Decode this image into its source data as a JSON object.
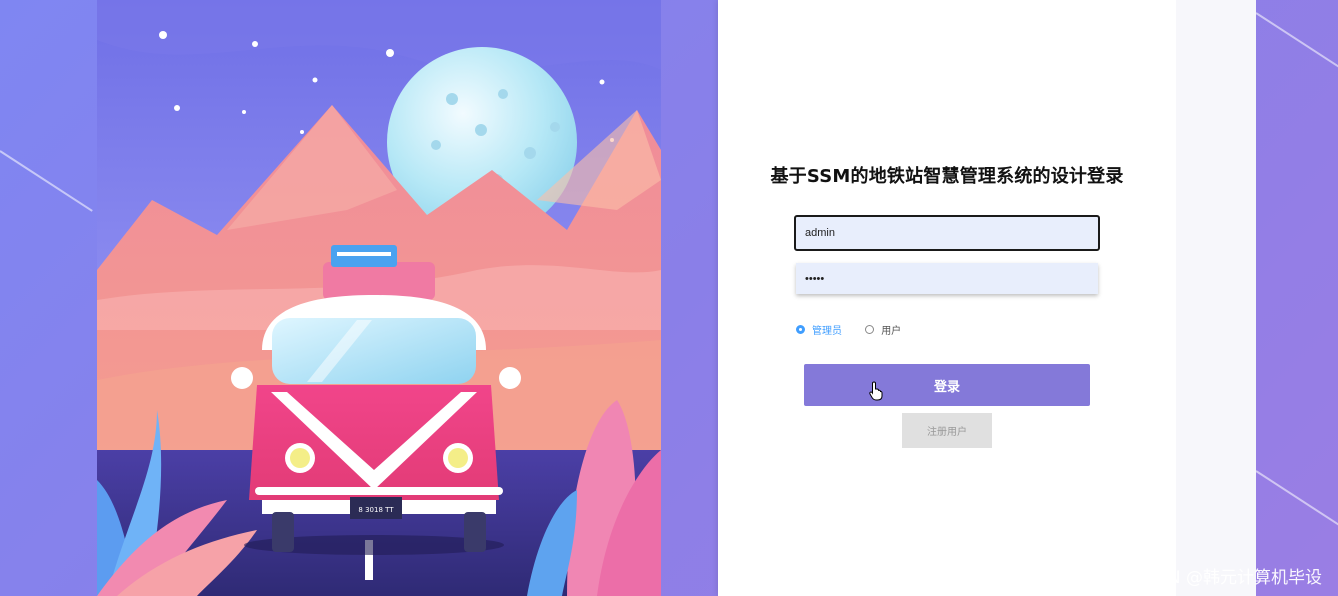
{
  "login": {
    "title": "基于SSM的地铁站智慧管理系统的设计登录",
    "username_value": "admin",
    "password_value": "•••••",
    "roles": [
      {
        "label": "管理员",
        "checked": true
      },
      {
        "label": "用户",
        "checked": false
      }
    ],
    "login_button": "登录",
    "register_button": "注册用户"
  },
  "illustration": {
    "plate_text": "8 3018 TT"
  },
  "watermark": "CSDN @韩元计算机毕设",
  "colors": {
    "accent": "#8479d9",
    "radio_active": "#409eff",
    "input_bg": "#e8eefc"
  },
  "icons": [
    "pointer-hand-icon",
    "radio-checked-icon",
    "radio-unchecked-icon"
  ]
}
